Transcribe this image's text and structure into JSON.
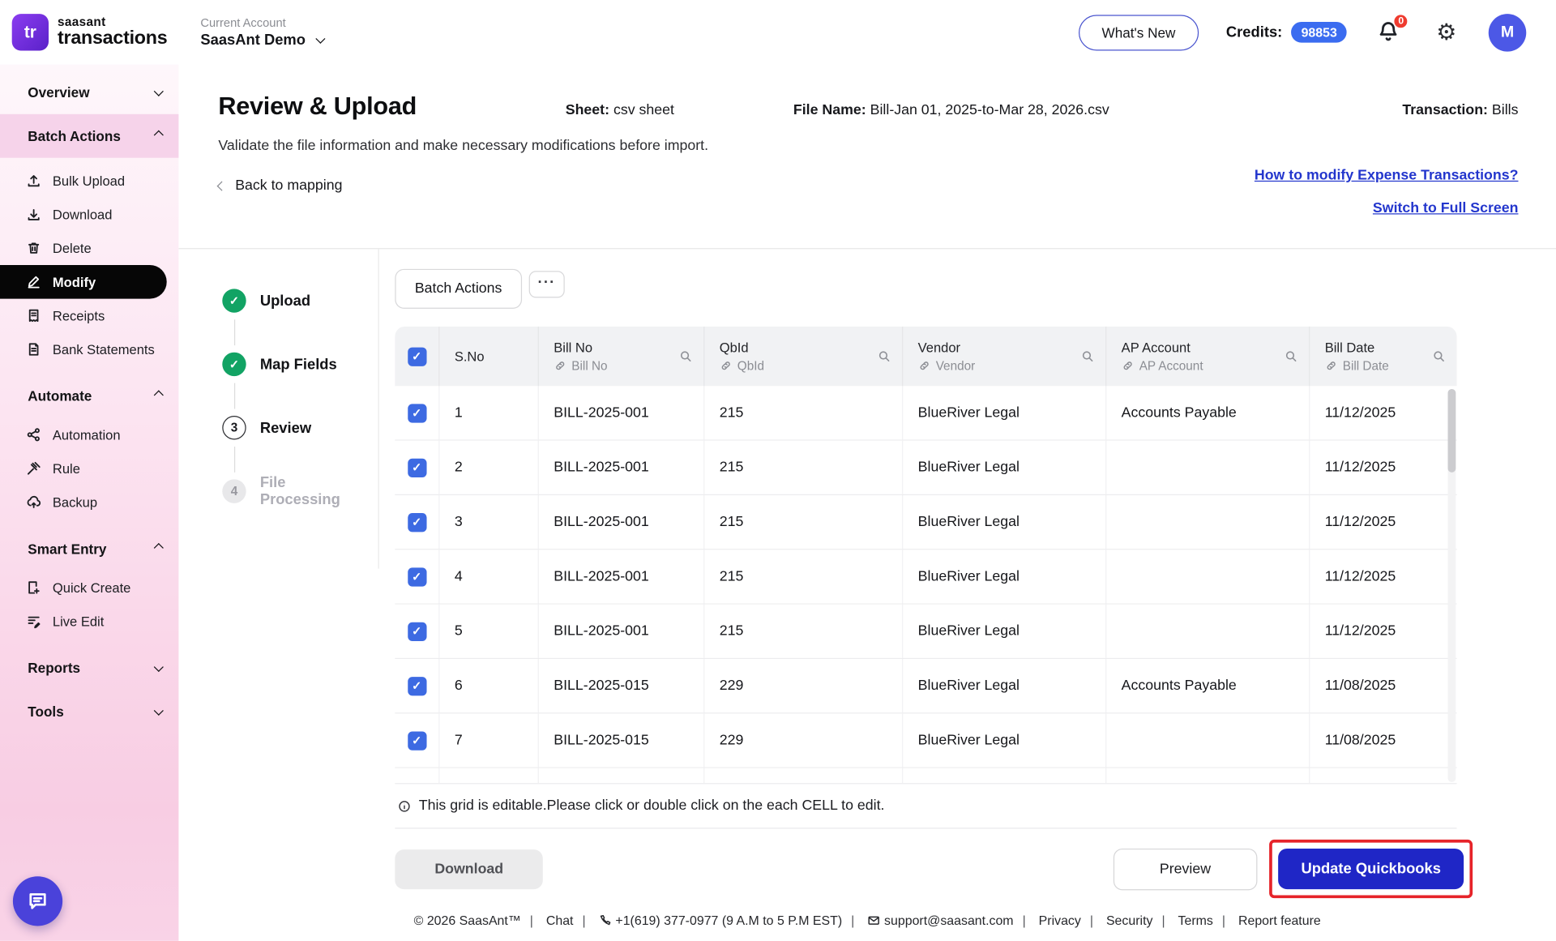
{
  "header": {
    "logo": "tr",
    "brand1": "saasant",
    "brand2": "transactions",
    "account_label": "Current Account",
    "account_name": "SaasAnt Demo",
    "whats_new": "What's New",
    "credits_label": "Credits:",
    "credits_value": "98853",
    "bell_badge": "0",
    "avatar": "M"
  },
  "sidebar": {
    "sections": [
      {
        "label": "Overview"
      },
      {
        "label": "Batch Actions"
      },
      {
        "label": "Automate"
      },
      {
        "label": "Smart Entry"
      },
      {
        "label": "Reports"
      },
      {
        "label": "Tools"
      }
    ],
    "batch_items": [
      "Bulk Upload",
      "Download",
      "Delete",
      "Modify",
      "Receipts",
      "Bank Statements"
    ],
    "automate_items": [
      "Automation",
      "Rule",
      "Backup"
    ],
    "smart_entry_items": [
      "Quick Create",
      "Live Edit"
    ]
  },
  "page": {
    "title": "Review & Upload",
    "sheet_label": "Sheet:",
    "sheet_value": "csv sheet",
    "file_label": "File Name:",
    "file_value": "Bill-Jan 01, 2025-to-Mar 28, 2026.csv",
    "transaction_label": "Transaction:",
    "transaction_value": "Bills",
    "description": "Validate the file information and make necessary modifications before import.",
    "back_link": "Back to mapping",
    "help_link": "How to modify Expense Transactions?",
    "fullscreen_link": "Switch to Full Screen"
  },
  "stepper": {
    "steps": [
      {
        "label": "Upload",
        "state": "done"
      },
      {
        "label": "Map Fields",
        "state": "done"
      },
      {
        "label": "Review",
        "state": "active",
        "number": "3"
      },
      {
        "label": "File Processing",
        "state": "pending",
        "number": "4"
      }
    ]
  },
  "grid": {
    "batch_actions_label": "Batch Actions",
    "more_label": "···",
    "columns": [
      {
        "title": "S.No"
      },
      {
        "title": "Bill No",
        "field": "Bill No"
      },
      {
        "title": "QbId",
        "field": "QbId"
      },
      {
        "title": "Vendor",
        "field": "Vendor"
      },
      {
        "title": "AP Account",
        "field": "AP Account"
      },
      {
        "title": "Bill Date",
        "field": "Bill Date"
      }
    ],
    "rows": [
      {
        "sno": "1",
        "bill_no": "BILL-2025-001",
        "qbid": "215",
        "vendor": "BlueRiver Legal",
        "ap_account": "Accounts Payable",
        "bill_date": "11/12/2025"
      },
      {
        "sno": "2",
        "bill_no": "BILL-2025-001",
        "qbid": "215",
        "vendor": "BlueRiver Legal",
        "ap_account": "",
        "bill_date": "11/12/2025"
      },
      {
        "sno": "3",
        "bill_no": "BILL-2025-001",
        "qbid": "215",
        "vendor": "BlueRiver Legal",
        "ap_account": "",
        "bill_date": "11/12/2025"
      },
      {
        "sno": "4",
        "bill_no": "BILL-2025-001",
        "qbid": "215",
        "vendor": "BlueRiver Legal",
        "ap_account": "",
        "bill_date": "11/12/2025"
      },
      {
        "sno": "5",
        "bill_no": "BILL-2025-001",
        "qbid": "215",
        "vendor": "BlueRiver Legal",
        "ap_account": "",
        "bill_date": "11/12/2025"
      },
      {
        "sno": "6",
        "bill_no": "BILL-2025-015",
        "qbid": "229",
        "vendor": "BlueRiver Legal",
        "ap_account": "Accounts Payable",
        "bill_date": "11/08/2025"
      },
      {
        "sno": "7",
        "bill_no": "BILL-2025-015",
        "qbid": "229",
        "vendor": "BlueRiver Legal",
        "ap_account": "",
        "bill_date": "11/08/2025"
      }
    ],
    "note": "This grid is editable.Please click or double click on the each CELL to edit."
  },
  "actions": {
    "download": "Download",
    "preview": "Preview",
    "update": "Update Quickbooks"
  },
  "footer": {
    "copyright": "© 2026 SaasAnt™",
    "chat": "Chat",
    "phone": "+1(619) 377-0977 (9 A.M to 5 P.M EST)",
    "email": "support@saasant.com",
    "privacy": "Privacy",
    "security": "Security",
    "terms": "Terms",
    "report": "Report feature"
  },
  "colors": {
    "accent_blue": "#1f26c6",
    "credits_blue": "#3b6cf0",
    "checkbox_blue": "#3d6ae2",
    "done_green": "#12a364",
    "annotation_red": "#e62329",
    "sidebar_pink": "#f8cde3"
  }
}
